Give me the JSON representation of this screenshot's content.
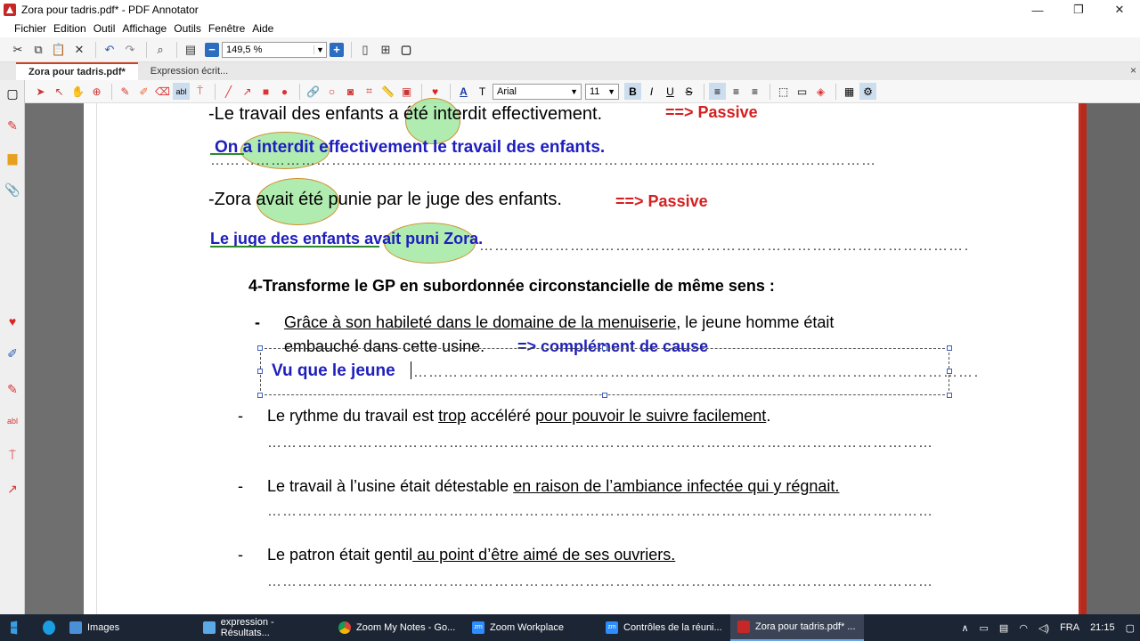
{
  "window": {
    "title": "Zora pour tadris.pdf* - PDF Annotator",
    "minimize": "—",
    "maximize": "❐",
    "close": "✕"
  },
  "menu": [
    "Fichier",
    "Edition",
    "Outil",
    "Affichage",
    "Outils",
    "Fenêtre",
    "Aide"
  ],
  "toolbar": {
    "zoom": "149,5 %"
  },
  "tabs": {
    "active": "Zora pour tadris.pdf*",
    "inactive": "Expression écrit...",
    "close": "×"
  },
  "format": {
    "font": "Arial",
    "size": "11"
  },
  "document": {
    "line1": "-Le travail des enfants ",
    "line1_oval": "a été",
    "line1_rest": " interdit effectivement.",
    "passive1": "==> Passive",
    "answer1_a": "On",
    "answer1_oval": "a interdit",
    "answer1_rest": " effectivement le travail des enfants.",
    "line2": "-Zora ",
    "line2_oval": "avait été",
    "line2_rest": " punie par le juge des enfants.",
    "passive2": "==> Passive",
    "answer2_a": "Le juge des enfants",
    "answer2_oval": "avait puni",
    "answer2_rest": " Zora.",
    "heading": "4-Transforme le GP en subordonnée circonstancielle de même sens :",
    "bullet_mark": "-",
    "item1_u": "Grâce à son habileté dans le domaine de la menuiserie",
    "item1_rest": ", le jeune homme était",
    "item1_line2": "embauché dans cette usine.",
    "item1_note": "=> complément de cause",
    "item1_answer": "Vu que le jeune",
    "item2_a": "Le rythme du travail est ",
    "item2_u1": "trop",
    "item2_b": " accéléré ",
    "item2_u2": "pour pouvoir le suivre facilement",
    "item2_c": ".",
    "item3_a": "Le travail à l’usine était détestable ",
    "item3_u": "en raison de l’ambiance infectée qui y régnait.",
    "item4_a": "Le patron était gentil",
    "item4_u": " au point d’être aimé de ses ouvriers.",
    "dots": "……………………………………………………………………………………………………………………"
  },
  "taskbar": {
    "items": [
      "Images",
      "expression - Résultats...",
      "Zoom My Notes - Go...",
      "Zoom Workplace",
      "Contrôles de la réuni...",
      "Zora pour tadris.pdf* ..."
    ],
    "lang": "FRA",
    "time": "21:15"
  }
}
